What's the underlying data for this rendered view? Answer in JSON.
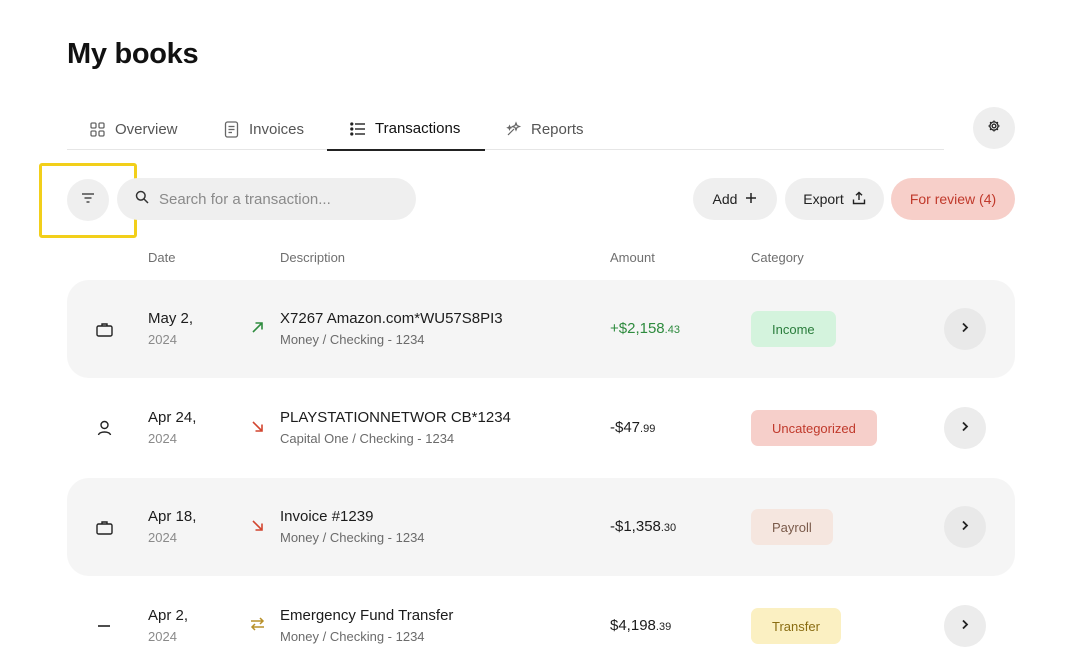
{
  "page": {
    "title": "My books"
  },
  "tabs": [
    {
      "label": "Overview",
      "icon": "grid-icon",
      "active": false
    },
    {
      "label": "Invoices",
      "icon": "document-icon",
      "active": false
    },
    {
      "label": "Transactions",
      "icon": "list-icon",
      "active": true
    },
    {
      "label": "Reports",
      "icon": "sparkles-icon",
      "active": false
    }
  ],
  "toolbar": {
    "search_placeholder": "Search for a transaction...",
    "add_label": "Add",
    "export_label": "Export",
    "review_label": "For review (4)"
  },
  "columns": {
    "date": "Date",
    "description": "Description",
    "amount": "Amount",
    "category": "Category"
  },
  "transactions": [
    {
      "icon": "briefcase-icon",
      "date": "May 2,",
      "year": "2024",
      "direction": "incoming-arrow-icon",
      "title": "X7267 Amazon.com*WU57S8PI3",
      "account": "Money / Checking - 1234",
      "amount_main": "+$2,158",
      "amount_cents": ".43",
      "category": "Income"
    },
    {
      "icon": "person-icon",
      "date": "Apr 24,",
      "year": "2024",
      "direction": "outgoing-arrow-icon",
      "title": "PLAYSTATIONNETWOR CB*1234",
      "account": "Capital One / Checking - 1234",
      "amount_main": "-$47",
      "amount_cents": ".99",
      "category": "Uncategorized"
    },
    {
      "icon": "briefcase-icon",
      "date": "Apr 18,",
      "year": "2024",
      "direction": "outgoing-arrow-icon",
      "title": "Invoice #1239",
      "account": "Money / Checking - 1234",
      "amount_main": "-$1,358",
      "amount_cents": ".30",
      "category": "Payroll"
    },
    {
      "icon": "dash-icon",
      "date": "Apr 2,",
      "year": "2024",
      "direction": "transfer-arrows-icon",
      "title": "Emergency Fund Transfer",
      "account": "Money / Checking - 1234",
      "amount_main": "$4,198",
      "amount_cents": ".39",
      "category": "Transfer"
    }
  ],
  "colors": {
    "income": "#2e8b3e",
    "outgoing": "#d2452f",
    "transfer": "#b8902a",
    "review_bg": "#f7cfc9",
    "highlight": "#f2cf1a"
  }
}
